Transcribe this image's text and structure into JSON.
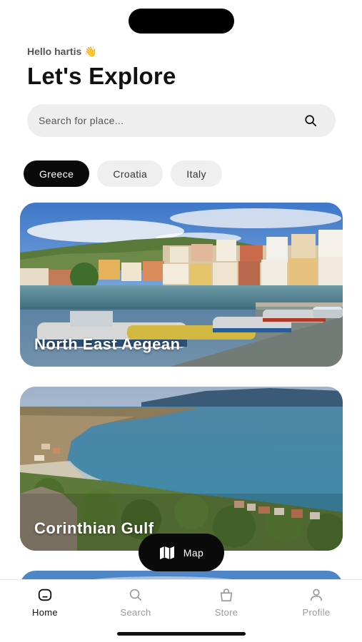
{
  "header": {
    "greeting": "Hello hartis 👋",
    "title": "Let's Explore"
  },
  "search": {
    "placeholder": "Search for place...",
    "icon": "search-icon"
  },
  "categories": [
    {
      "label": "Greece",
      "selected": true
    },
    {
      "label": "Croatia",
      "selected": false
    },
    {
      "label": "Italy",
      "selected": false
    }
  ],
  "places": [
    {
      "name": "North East Aegean"
    },
    {
      "name": "Corinthian Gulf"
    },
    {
      "name": ""
    }
  ],
  "map_button": {
    "label": "Map",
    "icon": "map-icon"
  },
  "tabbar": {
    "items": [
      {
        "label": "Home",
        "icon": "home-icon",
        "active": true
      },
      {
        "label": "Search",
        "icon": "search-icon",
        "active": false
      },
      {
        "label": "Store",
        "icon": "bag-icon",
        "active": false
      },
      {
        "label": "Profile",
        "icon": "person-icon",
        "active": false
      }
    ]
  },
  "colors": {
    "primary": "#0a0a0a",
    "chip_background": "#efefef",
    "search_background": "#eeeeee",
    "inactive_tab": "#999999"
  }
}
